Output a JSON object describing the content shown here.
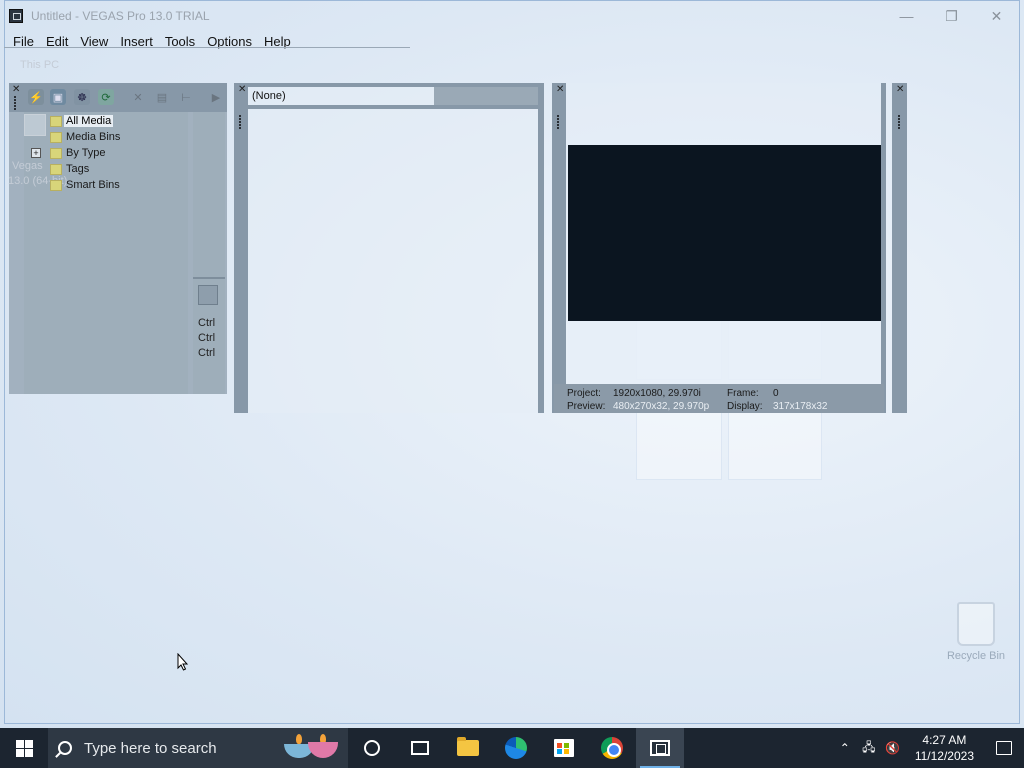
{
  "window": {
    "title": "Untitled - VEGAS Pro 13.0 TRIAL",
    "minimize_icon": "minimize-icon",
    "restore_icon": "restore-icon",
    "close_icon": "close-icon"
  },
  "menu": [
    "File",
    "Edit",
    "View",
    "Insert",
    "Tools",
    "Options",
    "Help"
  ],
  "ghost": {
    "this_pc": "This PC",
    "vegas_line1": "Vegas",
    "vegas_line2": "13.0 (64-bit)"
  },
  "explorer": {
    "tree": [
      "All Media",
      "Media Bins",
      "By Type",
      "Tags",
      "Smart Bins"
    ],
    "expand_symbol": "+",
    "ctrl_labels": [
      "Ctrl",
      "Ctrl",
      "Ctrl"
    ]
  },
  "trimmer": {
    "label": "(None)"
  },
  "preview": {
    "project_label": "Project:",
    "project_value": "1920x1080, 29.970i",
    "frame_label": "Frame:",
    "frame_value": "0",
    "preview_label": "Preview:",
    "preview_value": "480x270x32, 29.970p",
    "display_label": "Display:",
    "display_value": "317x178x32"
  },
  "desktop": {
    "recycle_bin": "Recycle Bin"
  },
  "taskbar": {
    "search_placeholder": "Type here to search",
    "time": "4:27 AM",
    "date": "11/12/2023"
  },
  "colors": {
    "taskbar_bg": "#1c2530",
    "panel_bg": "#a2b1bf",
    "preview_black": "#0b1520"
  }
}
